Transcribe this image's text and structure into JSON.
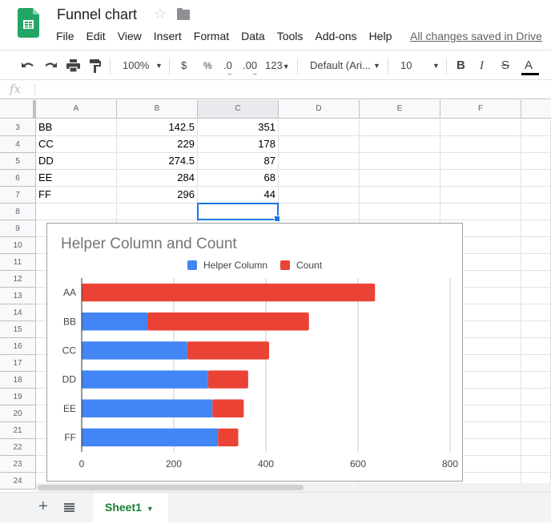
{
  "app": {
    "title": "Funnel chart",
    "star_icon": "☆",
    "save_status": "All changes saved in Drive",
    "menu": [
      "File",
      "Edit",
      "View",
      "Insert",
      "Format",
      "Data",
      "Tools",
      "Add-ons",
      "Help"
    ]
  },
  "toolbar": {
    "undo": "↶",
    "redo": "↷",
    "print": "print-icon",
    "paint_format": "paint-format-icon",
    "zoom": "100%",
    "currency": "$",
    "percent": "%",
    "decrease_decimal": ".0",
    "increase_decimal": ".00",
    "more_formats": "123",
    "font": "Default (Ari...",
    "font_size": "10",
    "bold": "B",
    "italic": "I",
    "strikethrough": "S",
    "text_color": "A"
  },
  "formula_bar": {
    "fx": "fx",
    "value": ""
  },
  "grid": {
    "columns": [
      "A",
      "B",
      "C",
      "D",
      "E",
      "F"
    ],
    "selected_column": "C",
    "selected_cell": "C8",
    "rows": [
      {
        "num": "3",
        "A": "BB",
        "B": "142.5",
        "C": "351"
      },
      {
        "num": "4",
        "A": "CC",
        "B": "229",
        "C": "178"
      },
      {
        "num": "5",
        "A": "DD",
        "B": "274.5",
        "C": "87"
      },
      {
        "num": "6",
        "A": "EE",
        "B": "284",
        "C": "68"
      },
      {
        "num": "7",
        "A": "FF",
        "B": "296",
        "C": "44"
      },
      {
        "num": "8",
        "A": "",
        "B": "",
        "C": ""
      },
      {
        "num": "9"
      },
      {
        "num": "10"
      },
      {
        "num": "11"
      },
      {
        "num": "12"
      },
      {
        "num": "13"
      },
      {
        "num": "14"
      },
      {
        "num": "15"
      },
      {
        "num": "16"
      },
      {
        "num": "17"
      },
      {
        "num": "18"
      },
      {
        "num": "19"
      },
      {
        "num": "20"
      },
      {
        "num": "21"
      },
      {
        "num": "22"
      },
      {
        "num": "23"
      },
      {
        "num": "24"
      }
    ]
  },
  "chart_data": {
    "type": "bar",
    "orientation": "horizontal",
    "stacked": true,
    "title": "Helper Column and Count",
    "categories": [
      "AA",
      "BB",
      "CC",
      "DD",
      "EE",
      "FF"
    ],
    "series": [
      {
        "name": "Helper Column",
        "color": "#4285f4",
        "values": [
          0,
          142.5,
          229,
          274.5,
          284,
          296
        ]
      },
      {
        "name": "Count",
        "color": "#ea4335",
        "values": [
          637,
          351,
          178,
          87,
          68,
          44
        ]
      }
    ],
    "xlim": [
      0,
      800
    ],
    "xticks": [
      "0",
      "200",
      "400",
      "600",
      "800"
    ],
    "grid": true,
    "legend": "top-center"
  },
  "sheets": {
    "add_label": "+",
    "tabs": [
      {
        "name": "Sheet1",
        "active": true
      }
    ]
  }
}
